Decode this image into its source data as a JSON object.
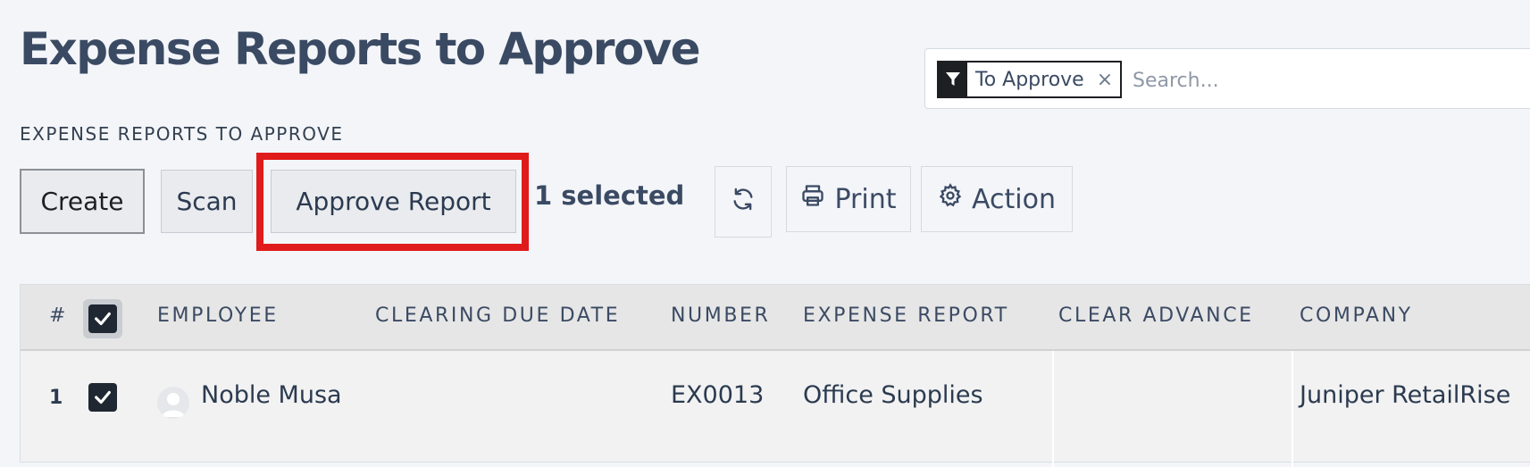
{
  "page": {
    "title": "Expense Reports to Approve",
    "breadcrumb": "EXPENSE REPORTS TO APPROVE"
  },
  "search": {
    "facet_label": "To Approve",
    "facet_remove": "×",
    "placeholder": "Search...",
    "value": ""
  },
  "toolbar": {
    "create_label": "Create",
    "scan_label": "Scan",
    "approve_label": "Approve Report",
    "selected_text": "1  selected",
    "print_label": "Print",
    "action_label": "Action"
  },
  "icons": {
    "facet": "filter-icon",
    "refresh": "refresh-icon",
    "print": "printer-icon",
    "action": "gear-icon",
    "checkbox": "check-icon",
    "avatar": "user-icon"
  },
  "colors": {
    "highlight": "#e01b1b",
    "title": "#3b4a63",
    "checkbox": "#1f2733"
  },
  "table": {
    "columns": [
      "#",
      "EMPLOYEE",
      "CLEARING DUE DATE",
      "NUMBER",
      "EXPENSE REPORT",
      "CLEAR ADVANCE",
      "COMPANY"
    ],
    "header_checked": true,
    "rows": [
      {
        "index": "1",
        "checked": true,
        "employee": "Noble Musa",
        "clearing_due_date": "",
        "number": "EX0013",
        "expense_report": "Office Supplies",
        "clear_advance": "",
        "company": "Juniper RetailRise"
      }
    ]
  }
}
